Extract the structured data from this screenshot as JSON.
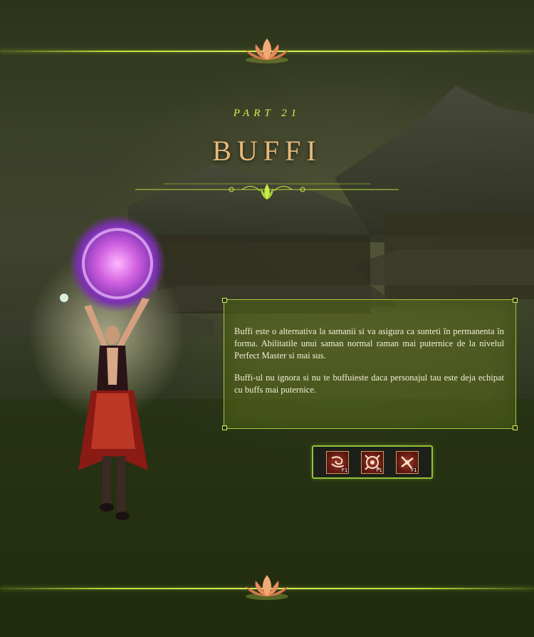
{
  "header": {
    "part_label": "PART 21",
    "title": "BUFFI"
  },
  "info": {
    "paragraphs": [
      "Buffi este o alternativa la samanii si va asigura ca sunteti în permanenta în forma. Abilitatile unui saman normal raman mai puternice de la nivelul Perfect Master si mai sus.",
      "Buffi-ul nu ignora si nu te buffuieste daca personajul tau este deja echipat cu buffs mai puternice."
    ]
  },
  "skills": [
    {
      "icon": "wind-swirl-icon",
      "hotkey": "F1"
    },
    {
      "icon": "rune-circle-icon",
      "hotkey": "F1"
    },
    {
      "icon": "spiral-blade-icon",
      "hotkey": "F1"
    }
  ],
  "colors": {
    "accent": "#b9e03a",
    "title": "#e7b97a",
    "part": "#d8f05a"
  }
}
